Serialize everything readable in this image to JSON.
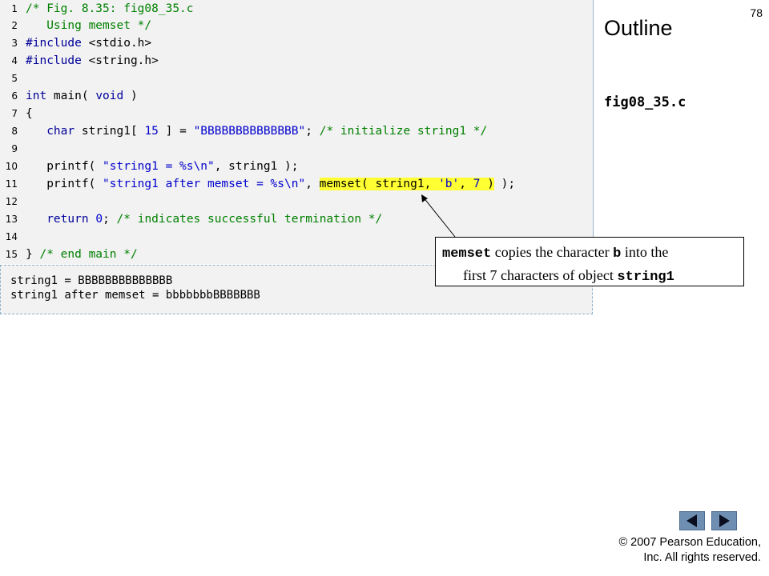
{
  "slide": {
    "number": "78"
  },
  "sidebar": {
    "title": "Outline",
    "file_name": "fig08_35.c"
  },
  "code": {
    "line_numbers": [
      "1",
      "2",
      "3",
      "4",
      "5",
      "6",
      "7",
      "8",
      "9",
      "10",
      "11",
      "12",
      "13",
      "14",
      "15"
    ],
    "l1": "/* Fig. 8.35: fig08_35.c",
    "l2": "   Using memset */",
    "l3_kw": "#include",
    "l3_rest": " <stdio.h>",
    "l4_kw": "#include",
    "l4_rest": " <string.h>",
    "l6_kw1": "int",
    "l6_mid": " main( ",
    "l6_kw2": "void",
    "l6_end": " )",
    "l7": "{",
    "l8_indent": "   ",
    "l8_kw": "char",
    "l8_a": " string1[ ",
    "l8_num": "15",
    "l8_b": " ] = ",
    "l8_str": "\"BBBBBBBBBBBBBB\"",
    "l8_c": "; ",
    "l8_cm": "/* initialize string1 */",
    "l10_a": "   printf( ",
    "l10_str": "\"string1 = %s\\n\"",
    "l10_b": ", string1 );",
    "l11_a": "   printf( ",
    "l11_str": "\"string1 after memset = %s\\n\"",
    "l11_b": ", ",
    "l11_hl_a": "memset( string1, ",
    "l11_hl_str": "'b'",
    "l11_hl_b": ", ",
    "l11_hl_num": "7",
    "l11_hl_c": " )",
    "l11_end": " );",
    "l13_indent": "   ",
    "l13_kw": "return",
    "l13_a": " ",
    "l13_num": "0",
    "l13_b": "; ",
    "l13_cm": "/* indicates successful termination */",
    "l15_a": "} ",
    "l15_cm": "/* end main */"
  },
  "output": {
    "line1": "string1 = BBBBBBBBBBBBBB",
    "line2": "string1 after memset = bbbbbbbBBBBBBB"
  },
  "callout": {
    "code1": "memset",
    "text1": " copies the character ",
    "code2": "b",
    "text2": " into the",
    "text3": "first 7 characters of object ",
    "code3": "string1"
  },
  "footer": {
    "copyright_line1": "© 2007 Pearson Education,",
    "copyright_line2": "Inc.  All rights reserved."
  },
  "colors": {
    "code_background": "#f2f2f2",
    "keyword": "#000099",
    "comment": "#008000",
    "literal": "#0000cc",
    "highlight": "#ffff33",
    "nav_button": "#6f8fb2"
  },
  "icons": {
    "prev": "triangle-left-icon",
    "next": "triangle-right-icon"
  }
}
